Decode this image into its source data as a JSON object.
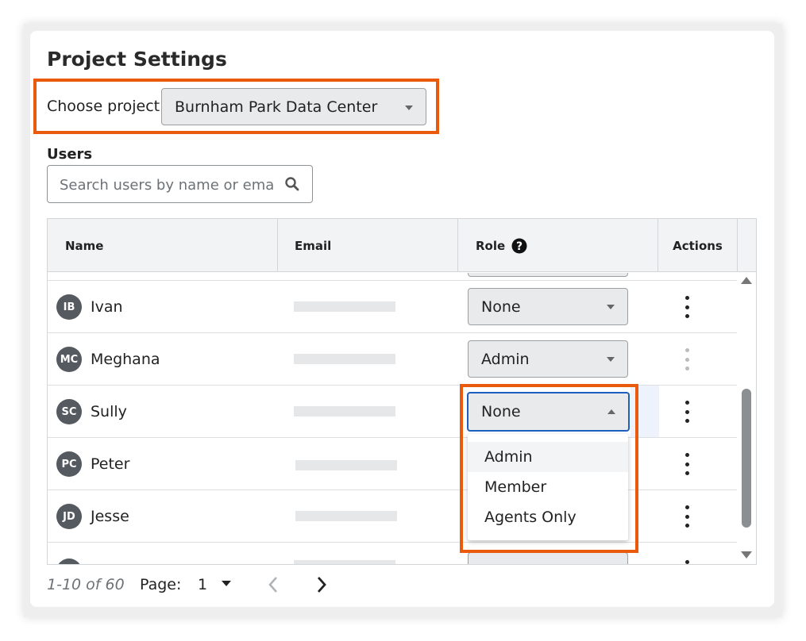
{
  "page": {
    "title": "Project Settings"
  },
  "project": {
    "label": "Choose project:",
    "selected": "Burnham Park Data Center"
  },
  "users": {
    "label": "Users",
    "search_placeholder": "Search users by name or email"
  },
  "table": {
    "columns": {
      "name": "Name",
      "email": "Email",
      "role": "Role",
      "actions": "Actions"
    },
    "rows": [
      {
        "initials": "IB",
        "name": "Ivan",
        "role": "None"
      },
      {
        "initials": "MC",
        "name": "Meghana",
        "role": "Admin"
      },
      {
        "initials": "SC",
        "name": "Sully",
        "role": "None"
      },
      {
        "initials": "PC",
        "name": "Peter",
        "role": ""
      },
      {
        "initials": "JD",
        "name": "Jesse",
        "role": ""
      }
    ]
  },
  "role_menu": {
    "options": [
      "Admin",
      "Member",
      "Agents Only"
    ],
    "highlighted": "Admin"
  },
  "pagination": {
    "range": "1-10 of 60",
    "page_label": "Page:",
    "page": "1"
  },
  "colors": {
    "highlight": "#ea5a0c",
    "focus": "#1d5fbf"
  },
  "icons": [
    "search-icon",
    "help-icon",
    "kebab-icon",
    "chevron-left-icon",
    "chevron-right-icon",
    "caret-down-icon"
  ]
}
